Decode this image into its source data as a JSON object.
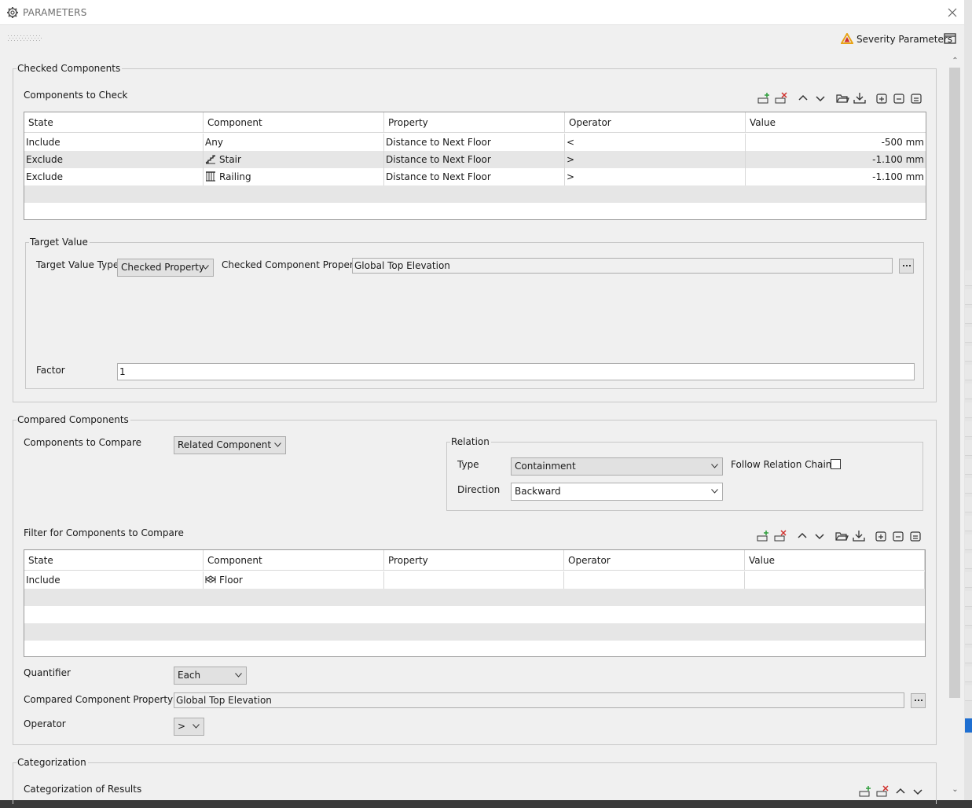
{
  "window": {
    "title": "PARAMETERS"
  },
  "header": {
    "severity_label": "Severity Parameters"
  },
  "checked": {
    "legend": "Checked Components",
    "components_label": "Components to Check",
    "columns": [
      "State",
      "Component",
      "Property",
      "Operator",
      "Value"
    ],
    "rows": [
      {
        "state": "Include",
        "component": "Any",
        "icon": "",
        "property": "Distance to Next Floor",
        "operator": "<",
        "value": "-500 mm"
      },
      {
        "state": "Exclude",
        "component": "Stair",
        "icon": "stair-icon",
        "property": "Distance to Next Floor",
        "operator": ">",
        "value": "-1.100 mm"
      },
      {
        "state": "Exclude",
        "component": "Railing",
        "icon": "railing-icon",
        "property": "Distance to Next Floor",
        "operator": ">",
        "value": "-1.100 mm"
      }
    ],
    "target": {
      "legend": "Target Value",
      "type_label": "Target Value Type",
      "type_value": "Checked Property",
      "prop_label": "Checked Component Property",
      "prop_value": "Global Top Elevation",
      "factor_label": "Factor",
      "factor_value": "1"
    }
  },
  "compared": {
    "legend": "Compared Components",
    "compare_label": "Components to Compare",
    "compare_value": "Related Component",
    "relation": {
      "legend": "Relation",
      "type_label": "Type",
      "type_value": "Containment",
      "follow_label": "Follow Relation Chain",
      "follow_checked": false,
      "direction_label": "Direction",
      "direction_value": "Backward"
    },
    "filter_label": "Filter for Components to Compare",
    "columns": [
      "State",
      "Component",
      "Property",
      "Operator",
      "Value"
    ],
    "rows": [
      {
        "state": "Include",
        "component": "Floor",
        "icon": "floor-icon",
        "property": "",
        "operator": "",
        "value": ""
      }
    ],
    "quantifier_label": "Quantifier",
    "quantifier_value": "Each",
    "prop_label": "Compared Component Property",
    "prop_value": "Global Top Elevation",
    "operator_label": "Operator",
    "operator_value": ">"
  },
  "categorization": {
    "legend": "Categorization",
    "results_label": "Categorization of Results"
  },
  "colors": {
    "add": "#2e9e3b",
    "delete": "#d0312d",
    "severity": "#e8a317"
  }
}
